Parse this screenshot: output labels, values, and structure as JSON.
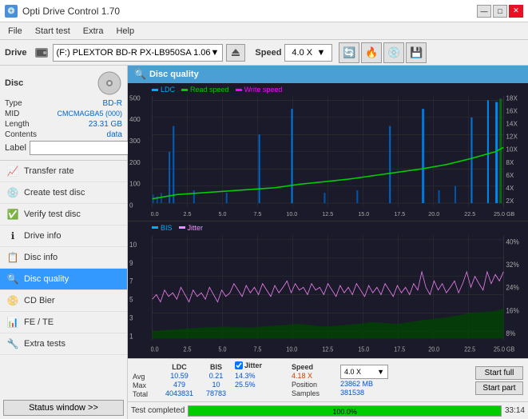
{
  "app": {
    "title": "Opti Drive Control 1.70",
    "icon": "💿"
  },
  "title_controls": {
    "minimize": "—",
    "maximize": "□",
    "close": "✕"
  },
  "menu": {
    "items": [
      "File",
      "Start test",
      "Extra",
      "Help"
    ]
  },
  "toolbar": {
    "drive_label": "Drive",
    "drive_icon": "💾",
    "drive_value": "(F:)  PLEXTOR BD-R  PX-LB950SA 1.06",
    "speed_label": "Speed",
    "speed_value": "4.0 X"
  },
  "disc_panel": {
    "label": "Disc",
    "type_key": "Type",
    "type_val": "BD-R",
    "mid_key": "MID",
    "mid_val": "CMCMAGBA5 (000)",
    "length_key": "Length",
    "length_val": "23.31 GB",
    "contents_key": "Contents",
    "contents_val": "data",
    "label_key": "Label",
    "label_val": ""
  },
  "nav": {
    "items": [
      {
        "id": "transfer-rate",
        "label": "Transfer rate",
        "icon": "📈"
      },
      {
        "id": "create-test-disc",
        "label": "Create test disc",
        "icon": "💿"
      },
      {
        "id": "verify-test-disc",
        "label": "Verify test disc",
        "icon": "✅"
      },
      {
        "id": "drive-info",
        "label": "Drive info",
        "icon": "ℹ️"
      },
      {
        "id": "disc-info",
        "label": "Disc info",
        "icon": "📋"
      },
      {
        "id": "disc-quality",
        "label": "Disc quality",
        "icon": "🔍",
        "active": true
      },
      {
        "id": "cd-bier",
        "label": "CD Bier",
        "icon": "🍺"
      },
      {
        "id": "fe-te",
        "label": "FE / TE",
        "icon": "📊"
      },
      {
        "id": "extra-tests",
        "label": "Extra tests",
        "icon": "🔧"
      }
    ]
  },
  "status_btn": "Status window >>",
  "disc_quality": {
    "title": "Disc quality",
    "upper_chart": {
      "legend": [
        {
          "label": "LDC",
          "color": "#00aaff"
        },
        {
          "label": "Read speed",
          "color": "#00cc00"
        },
        {
          "label": "Write speed",
          "color": "#ff00ff"
        }
      ],
      "y_left_max": 500,
      "y_right_labels": [
        "18X",
        "16X",
        "14X",
        "12X",
        "10X",
        "8X",
        "6X",
        "4X",
        "2X"
      ],
      "x_labels": [
        "0.0",
        "2.5",
        "5.0",
        "7.5",
        "10.0",
        "12.5",
        "15.0",
        "17.5",
        "20.0",
        "22.5",
        "25.0 GB"
      ]
    },
    "lower_chart": {
      "legend": [
        {
          "label": "BIS",
          "color": "#00aaff"
        },
        {
          "label": "Jitter",
          "color": "#ff88ff"
        }
      ],
      "y_left_max": 10,
      "y_right_labels": [
        "40%",
        "32%",
        "24%",
        "16%",
        "8%"
      ],
      "x_labels": [
        "0.0",
        "2.5",
        "5.0",
        "7.5",
        "10.0",
        "12.5",
        "15.0",
        "17.5",
        "20.0",
        "22.5",
        "25.0 GB"
      ]
    }
  },
  "stats": {
    "headers": [
      "LDC",
      "BIS",
      "",
      "Jitter",
      "Speed",
      "",
      ""
    ],
    "avg_label": "Avg",
    "avg_ldc": "10.59",
    "avg_bis": "0.21",
    "avg_jitter": "14.3%",
    "avg_speed": "4.18 X",
    "speed_dropdown": "4.0 X",
    "max_label": "Max",
    "max_ldc": "479",
    "max_bis": "10",
    "max_jitter": "25.5%",
    "position_label": "Position",
    "position_val": "23862 MB",
    "total_label": "Total",
    "total_ldc": "4043831",
    "total_bis": "78783",
    "samples_label": "Samples",
    "samples_val": "381538",
    "jitter_checked": true,
    "start_full": "Start full",
    "start_part": "Start part"
  },
  "bottom": {
    "status_text": "Test completed",
    "progress_pct": 100,
    "progress_label": "100.0%",
    "time": "33:14"
  }
}
